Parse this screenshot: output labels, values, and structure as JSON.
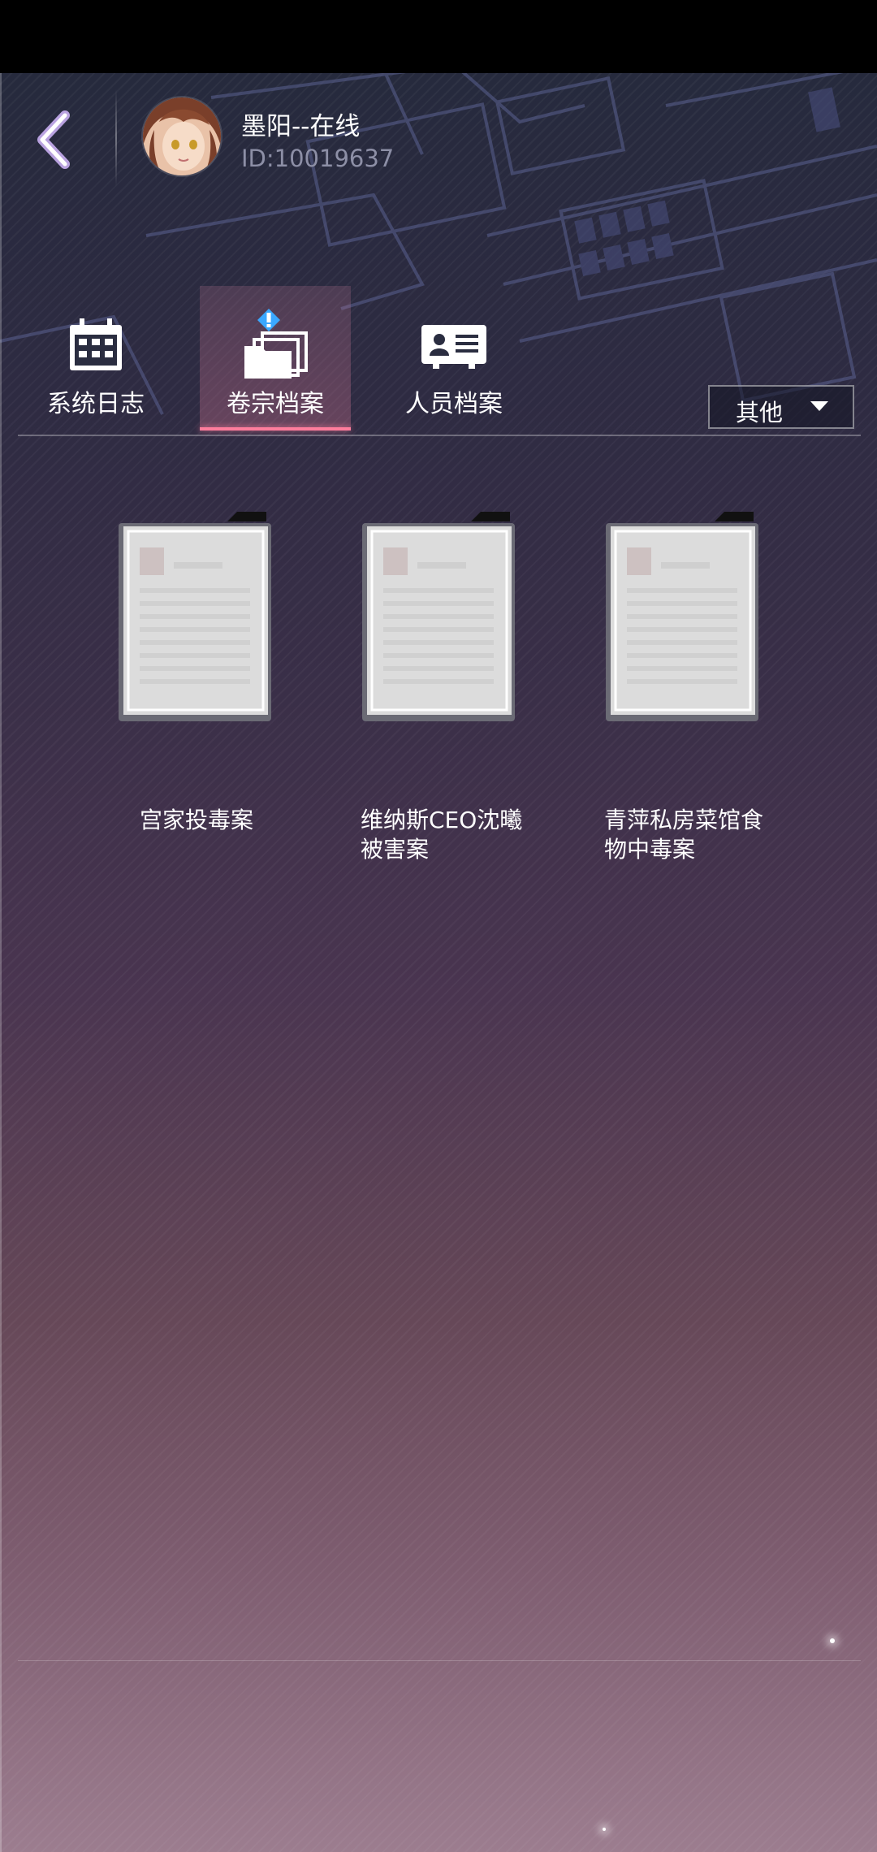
{
  "header": {
    "back_icon": "chevron-left-icon",
    "user_name": "墨阳--在线",
    "user_id": "ID:10019637"
  },
  "tabs": [
    {
      "label": "系统日志",
      "icon": "calendar-icon",
      "active": false
    },
    {
      "label": "卷宗档案",
      "icon": "folder-alert-icon",
      "active": true
    },
    {
      "label": "人员档案",
      "icon": "id-card-icon",
      "active": false
    }
  ],
  "dropdown": {
    "label": "其他",
    "icon": "caret-down-icon"
  },
  "cases": [
    {
      "title": "宫家投毒案"
    },
    {
      "title": "维纳斯CEO沈曦被害案"
    },
    {
      "title": "青萍私房菜馆食物中毒案"
    }
  ],
  "colors": {
    "active_tab_underline": "#ff7d9c",
    "alert_badge": "#3aa8ff",
    "text_primary": "#ffffff",
    "text_secondary": "#8d8fa6"
  }
}
